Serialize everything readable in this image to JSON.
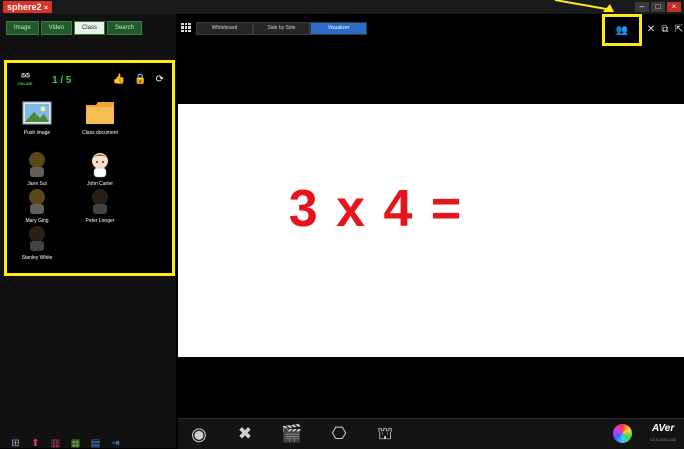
{
  "titlebar": {
    "app_name": "sphere2"
  },
  "left_tabs": [
    "Image",
    "Video",
    "Class",
    "Search"
  ],
  "class_panel": {
    "online_label": "ONLINE",
    "online_count": "1 / 5",
    "items": [
      {
        "label": "Push image",
        "icon": "image-icon"
      },
      {
        "label": "Class document",
        "icon": "folder-icon"
      },
      {
        "label": "Jane Sui",
        "icon": "student-avatar-icon"
      },
      {
        "label": "John Carter",
        "icon": "student-avatar-icon"
      },
      {
        "label": "Mary Ging",
        "icon": "student-avatar-icon"
      },
      {
        "label": "Peter Longer",
        "icon": "student-avatar-icon"
      },
      {
        "label": "Stanley White",
        "icon": "student-avatar-icon"
      }
    ]
  },
  "main_tabs": [
    "Whiteboard",
    "Side by Side",
    "Visualizer"
  ],
  "whiteboard": {
    "content": "3 x 4 ="
  },
  "brand": {
    "logo": "AVer",
    "version": "V2.5.2101.102"
  },
  "colors": {
    "accent_yellow": "#ffe81a",
    "equation_red": "#e6151d",
    "tab_blue": "#2d6bc9",
    "tab_green": "#1f5a2a"
  }
}
